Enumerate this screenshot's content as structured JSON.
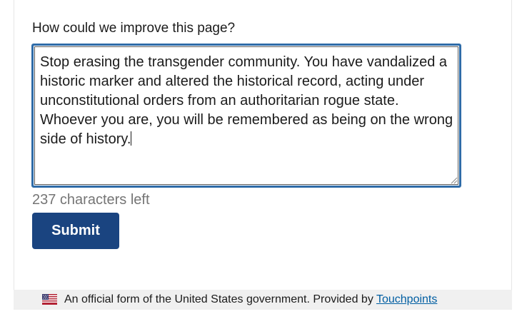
{
  "form": {
    "question_label": "How could we improve this page?",
    "feedback_value": "Stop erasing the transgender community. You have vandalized a historic marker and altered the historical record, acting under unconstitutional orders from an authoritarian rogue state. Whoever you are, you will be remembered as being on the wrong side of history.",
    "characters_left": "237 characters left",
    "submit_label": "Submit"
  },
  "footer": {
    "statement": "An official form of the United States government. Provided by ",
    "link_label": "Touchpoints",
    "icon": "us-flag-icon"
  },
  "colors": {
    "focus_border": "#2f6ca8",
    "button_bg": "#1a4480",
    "link": "#005ea2",
    "footer_bg": "#f0f0f0",
    "muted_text": "#757575"
  }
}
